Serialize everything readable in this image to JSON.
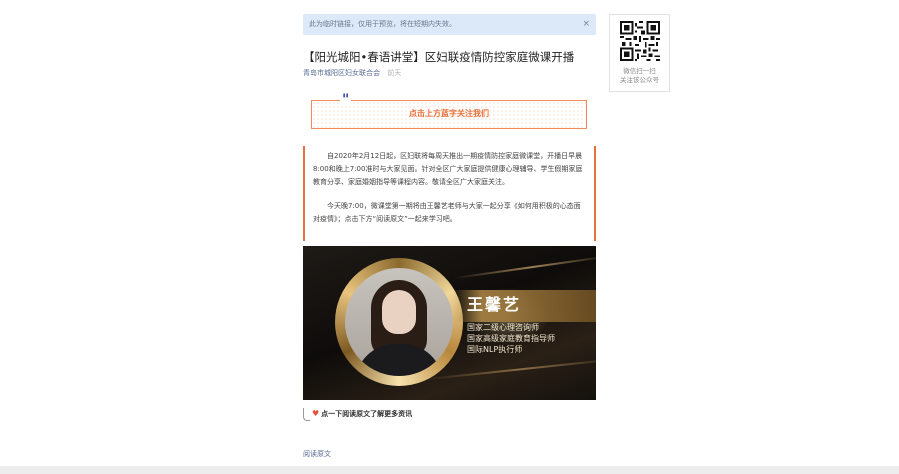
{
  "notice": {
    "text": "此为临时链接，仅用于预览，将在短期内失效。",
    "close_icon": "×"
  },
  "article": {
    "title": "【阳光城阳•春语讲堂】区妇联疫情防控家庭微课开播",
    "author": "青岛市城阳区妇女联合会",
    "time": "前天"
  },
  "follow_banner": {
    "quote_glyph": "\"",
    "text": "点击上方蓝字关注我们"
  },
  "body": {
    "paragraph1": "自2020年2月12日起，区妇联将每周天推出一期疫情防控家庭微课堂，开播日早晨8:00和晚上7:00准时与大家见面。针对全区广大家庭提供健康心理辅导、学生假期家庭教育分享、家庭婚姻指导等课程内容。敬请全区广大家庭关注。",
    "paragraph2": "今天晚7:00，微课堂第一期将由王馨艺老师与大家一起分享《如何用积极的心态面对疫情》；点击下方“阅读原文”一起来学习吧。"
  },
  "banner": {
    "name": "王馨艺",
    "credentials": [
      "国家二级心理咨询师",
      "国家高级家庭教育指导师",
      "国际NLP执行师"
    ]
  },
  "tip": {
    "heart_icon": "♥",
    "text": "点一下阅读原文了解更多资讯"
  },
  "read_original": "阅读原文",
  "qr": {
    "caption_line1": "微信扫一扫",
    "caption_line2": "关注该公众号"
  },
  "colors": {
    "accent_orange": "#e8703a",
    "link_blue": "#576b95",
    "notice_bg": "#dbe9f9"
  }
}
